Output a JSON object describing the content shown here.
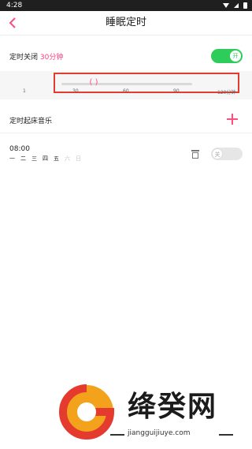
{
  "status_bar": {
    "time": "4:28"
  },
  "header": {
    "title": "睡眠定时"
  },
  "timer_off": {
    "label_prefix": "定时关闭 ",
    "label_value": "30分钟",
    "toggle_text": "开"
  },
  "slider": {
    "value_minutes": 30,
    "min": 1,
    "max": 120,
    "thumb_text": "( )",
    "ticks": [
      "1",
      "30",
      "60",
      "90",
      "120分钟"
    ]
  },
  "wake_music": {
    "label": "定时起床音乐"
  },
  "alarm": {
    "time": "08:00",
    "days": [
      {
        "label": "一",
        "active": true
      },
      {
        "label": "二",
        "active": true
      },
      {
        "label": "三",
        "active": true
      },
      {
        "label": "四",
        "active": true
      },
      {
        "label": "五",
        "active": true
      },
      {
        "label": "六",
        "active": false
      },
      {
        "label": "日",
        "active": false
      }
    ],
    "toggle_text": "关"
  },
  "watermark": {
    "cn": "绛癸网",
    "domain": "jiangguijiuye.com"
  },
  "colors": {
    "accent": "#ff4d7e",
    "toggle_on": "#2ecc5a",
    "highlight_box": "#e23b2f"
  }
}
